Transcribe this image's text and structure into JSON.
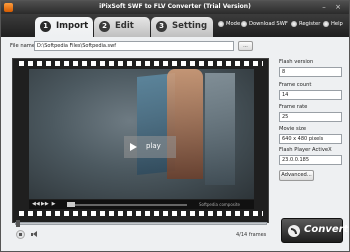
{
  "window": {
    "title": "iPixSoft SWF to FLV Converter (Trial Version)",
    "minimize_glyph": "–",
    "close_glyph": "×"
  },
  "tabs": [
    {
      "number": "1",
      "label": "Import",
      "active": true
    },
    {
      "number": "2",
      "label": "Edit",
      "active": false
    },
    {
      "number": "3",
      "label": "Setting",
      "active": false
    }
  ],
  "top_menu": {
    "mode": "Mode",
    "download": "Download SWF",
    "register": "Register",
    "help": "Help"
  },
  "file": {
    "label": "File name:",
    "value": "D:\\Softpedia Files\\Softpedia.swf",
    "browse_label": "..."
  },
  "preview": {
    "play_label": "play",
    "watermark": "Softpedia  composite",
    "controls": {
      "prev": "◀◀",
      "next": "▶▶",
      "play": "▶"
    }
  },
  "playback": {
    "position": 0.0,
    "frames_text": "4/14 frames"
  },
  "info": {
    "flash_version_label": "Flash version",
    "flash_version": "8",
    "frame_count_label": "Frame count",
    "frame_count": "14",
    "frame_rate_label": "Frame rate",
    "frame_rate": "25",
    "movie_size_label": "Movie size",
    "movie_size": "640 x 480 pixels",
    "player_label": "Flash Player ActiveX",
    "player_version": "23.0.0.185"
  },
  "advanced_label": "Advanced...",
  "convert_label": "Convert",
  "colors": {
    "titlebar": "#2b2b2b",
    "accent": "#ff8a1e",
    "panel": "#eef0f2"
  }
}
